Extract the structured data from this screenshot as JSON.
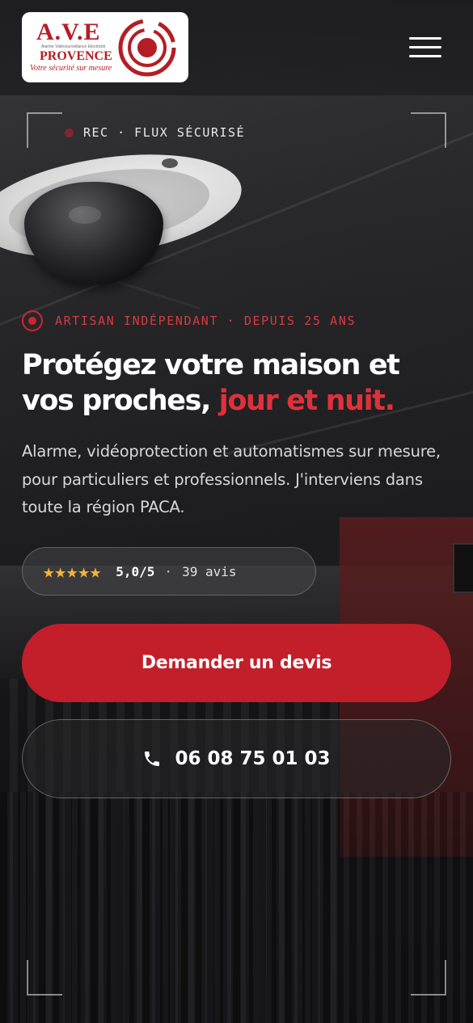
{
  "header": {
    "logo": {
      "word": "A.V.E",
      "micro": "Alarme Vidéosurveillance Electricité",
      "name": "PROVENCE",
      "slogan": "Votre sécurité sur mesure"
    },
    "menu_icon": "hamburger-menu-icon"
  },
  "overlay": {
    "rec_label": "REC · FLUX SÉCURISÉ"
  },
  "hero": {
    "eyebrow": "ARTISAN INDÉPENDANT · DEPUIS 25 ANS",
    "headline_main": "Protégez votre maison et vos proches, ",
    "headline_accent": "jour et nuit.",
    "subtitle": "Alarme, vidéoprotection et automatismes sur mesure, pour particuliers et professionnels. J'interviens dans toute la région PACA.",
    "rating": {
      "stars": "★★★★★",
      "score": "5,0/5",
      "separator": "·",
      "count": "39 avis"
    },
    "cta_quote": "Demander un devis",
    "cta_phone": "06 08 75 01 03"
  },
  "colors": {
    "accent": "#c21f2b",
    "accent_text": "#e0313b",
    "star": "#f3b53b"
  }
}
